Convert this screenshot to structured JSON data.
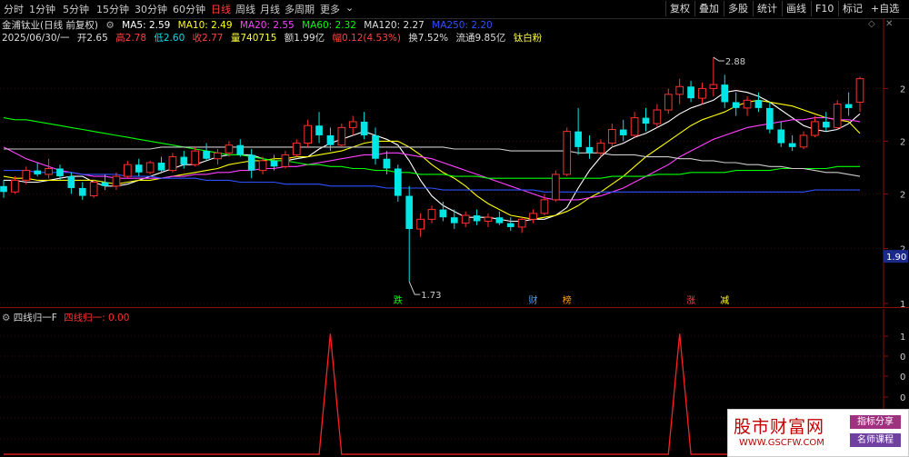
{
  "toolbar": {
    "timeframes": [
      "分时",
      "1分钟",
      "5分钟",
      "15分钟",
      "30分钟",
      "60分钟",
      "日线",
      "周线",
      "月线",
      "多周期",
      "更多"
    ],
    "active": "日线",
    "right_buttons": [
      "复权",
      "叠加",
      "多股",
      "统计",
      "画线",
      "F10",
      "标记",
      "+自选",
      "◁",
      "▷"
    ]
  },
  "header": {
    "stock_title": "金浦钛业(日线 前复权)",
    "ma_labels": [
      {
        "text": "MA5: 2.59",
        "color": "#ffffff"
      },
      {
        "text": "MA10: 2.49",
        "color": "#ffff00"
      },
      {
        "text": "MA20: 2.55",
        "color": "#ff40ff"
      },
      {
        "text": "MA60: 2.32",
        "color": "#00ff00"
      },
      {
        "text": "MA120: 2.27",
        "color": "#dddddd"
      },
      {
        "text": "MA250: 2.20",
        "color": "#3050ff"
      }
    ],
    "bar_info": [
      {
        "text": "2025/06/30/一",
        "color": "#dddddd"
      },
      {
        "text": "开2.65",
        "color": "#dddddd"
      },
      {
        "text": "高2.78",
        "color": "#ff4040"
      },
      {
        "text": "低2.60",
        "color": "#00e0e0"
      },
      {
        "text": "收2.77",
        "color": "#ff4040"
      },
      {
        "text": "量740715",
        "color": "#ffff40"
      },
      {
        "text": "额1.99亿",
        "color": "#dddddd"
      },
      {
        "text": "幅0.12(4.53%)",
        "color": "#ff4040"
      },
      {
        "text": "换7.52%",
        "color": "#dddddd"
      },
      {
        "text": "流通9.85亿",
        "color": "#dddddd"
      },
      {
        "text": "钛白粉",
        "color": "#ffff40"
      }
    ]
  },
  "chart_data": [
    {
      "type": "candlestick",
      "title": "金浦钛业(日线 前复权)",
      "ylim": [
        1.6,
        2.95
      ],
      "y_ticks": [
        "2",
        "2",
        "2",
        "2",
        "1"
      ],
      "price_marker": "1.90",
      "annotations": [
        {
          "text": "2.88",
          "kind": "high",
          "value": 2.88
        },
        {
          "text": "1.73",
          "kind": "low",
          "value": 1.73
        }
      ],
      "event_tags": [
        {
          "text": "跌",
          "color": "#00ff00",
          "index": 35
        },
        {
          "text": "财",
          "color": "#40a0ff",
          "index": 47
        },
        {
          "text": "榜",
          "color": "#ffa000",
          "index": 50
        },
        {
          "text": "涨",
          "color": "#ff4040",
          "index": 61
        },
        {
          "text": "减",
          "color": "#ffff00",
          "index": 64
        }
      ],
      "ohlc": [
        [
          2.22,
          2.25,
          2.16,
          2.19
        ],
        [
          2.19,
          2.27,
          2.18,
          2.25
        ],
        [
          2.25,
          2.32,
          2.23,
          2.3
        ],
        [
          2.3,
          2.34,
          2.27,
          2.28
        ],
        [
          2.28,
          2.36,
          2.26,
          2.31
        ],
        [
          2.31,
          2.33,
          2.25,
          2.27
        ],
        [
          2.27,
          2.29,
          2.18,
          2.21
        ],
        [
          2.21,
          2.24,
          2.15,
          2.17
        ],
        [
          2.17,
          2.25,
          2.16,
          2.24
        ],
        [
          2.24,
          2.28,
          2.2,
          2.22
        ],
        [
          2.22,
          2.29,
          2.2,
          2.27
        ],
        [
          2.27,
          2.35,
          2.26,
          2.33
        ],
        [
          2.33,
          2.36,
          2.27,
          2.29
        ],
        [
          2.29,
          2.35,
          2.28,
          2.34
        ],
        [
          2.34,
          2.37,
          2.29,
          2.3
        ],
        [
          2.3,
          2.39,
          2.29,
          2.37
        ],
        [
          2.37,
          2.4,
          2.31,
          2.33
        ],
        [
          2.33,
          2.42,
          2.32,
          2.4
        ],
        [
          2.4,
          2.44,
          2.35,
          2.36
        ],
        [
          2.36,
          2.41,
          2.33,
          2.39
        ],
        [
          2.39,
          2.45,
          2.37,
          2.43
        ],
        [
          2.43,
          2.46,
          2.37,
          2.38
        ],
        [
          2.38,
          2.41,
          2.26,
          2.3
        ],
        [
          2.3,
          2.37,
          2.28,
          2.35
        ],
        [
          2.35,
          2.38,
          2.3,
          2.32
        ],
        [
          2.32,
          2.4,
          2.31,
          2.38
        ],
        [
          2.38,
          2.46,
          2.37,
          2.44
        ],
        [
          2.44,
          2.56,
          2.42,
          2.53
        ],
        [
          2.53,
          2.6,
          2.44,
          2.48
        ],
        [
          2.48,
          2.52,
          2.4,
          2.43
        ],
        [
          2.43,
          2.54,
          2.42,
          2.52
        ],
        [
          2.52,
          2.58,
          2.48,
          2.55
        ],
        [
          2.55,
          2.6,
          2.46,
          2.48
        ],
        [
          2.48,
          2.52,
          2.33,
          2.36
        ],
        [
          2.36,
          2.4,
          2.28,
          2.31
        ],
        [
          2.31,
          2.33,
          2.14,
          2.17
        ],
        [
          2.17,
          2.22,
          1.73,
          2.0
        ],
        [
          2.0,
          2.08,
          1.96,
          2.05
        ],
        [
          2.05,
          2.12,
          2.03,
          2.1
        ],
        [
          2.1,
          2.14,
          2.04,
          2.06
        ],
        [
          2.06,
          2.1,
          2.0,
          2.03
        ],
        [
          2.03,
          2.09,
          2.01,
          2.07
        ],
        [
          2.07,
          2.1,
          2.02,
          2.04
        ],
        [
          2.04,
          2.08,
          2.01,
          2.06
        ],
        [
          2.06,
          2.09,
          2.02,
          2.03
        ],
        [
          2.03,
          2.06,
          1.99,
          2.01
        ],
        [
          2.01,
          2.06,
          1.98,
          2.05
        ],
        [
          2.05,
          2.1,
          2.03,
          2.08
        ],
        [
          2.08,
          2.18,
          2.07,
          2.15
        ],
        [
          2.15,
          2.3,
          2.14,
          2.28
        ],
        [
          2.28,
          2.52,
          2.27,
          2.5
        ],
        [
          2.5,
          2.62,
          2.38,
          2.42
        ],
        [
          2.42,
          2.48,
          2.36,
          2.39
        ],
        [
          2.39,
          2.46,
          2.37,
          2.44
        ],
        [
          2.44,
          2.54,
          2.42,
          2.51
        ],
        [
          2.51,
          2.56,
          2.45,
          2.48
        ],
        [
          2.48,
          2.6,
          2.47,
          2.57
        ],
        [
          2.57,
          2.62,
          2.5,
          2.54
        ],
        [
          2.54,
          2.64,
          2.52,
          2.61
        ],
        [
          2.61,
          2.72,
          2.59,
          2.69
        ],
        [
          2.69,
          2.77,
          2.64,
          2.73
        ],
        [
          2.73,
          2.76,
          2.65,
          2.67
        ],
        [
          2.67,
          2.75,
          2.64,
          2.72
        ],
        [
          2.72,
          2.88,
          2.68,
          2.74
        ],
        [
          2.74,
          2.79,
          2.62,
          2.65
        ],
        [
          2.65,
          2.7,
          2.58,
          2.62
        ],
        [
          2.62,
          2.68,
          2.58,
          2.66
        ],
        [
          2.66,
          2.7,
          2.6,
          2.62
        ],
        [
          2.62,
          2.65,
          2.49,
          2.51
        ],
        [
          2.51,
          2.55,
          2.42,
          2.44
        ],
        [
          2.44,
          2.48,
          2.4,
          2.42
        ],
        [
          2.42,
          2.5,
          2.41,
          2.48
        ],
        [
          2.48,
          2.58,
          2.47,
          2.55
        ],
        [
          2.55,
          2.6,
          2.5,
          2.52
        ],
        [
          2.52,
          2.66,
          2.51,
          2.64
        ],
        [
          2.64,
          2.7,
          2.58,
          2.62
        ],
        [
          2.65,
          2.78,
          2.6,
          2.77
        ]
      ],
      "ma": [
        {
          "name": "MA5",
          "color": "#ffffff",
          "values": [
            2.25,
            2.25,
            2.24,
            2.24,
            2.25,
            2.26,
            2.27,
            2.27,
            2.24,
            2.22,
            2.22,
            2.23,
            2.25,
            2.27,
            2.29,
            2.31,
            2.33,
            2.33,
            2.35,
            2.37,
            2.38,
            2.38,
            2.38,
            2.36,
            2.35,
            2.35,
            2.36,
            2.37,
            2.41,
            2.44,
            2.46,
            2.48,
            2.5,
            2.48,
            2.46,
            2.43,
            2.35,
            2.25,
            2.17,
            2.12,
            2.09,
            2.06,
            2.06,
            2.06,
            2.05,
            2.04,
            2.04,
            2.05,
            2.05,
            2.07,
            2.11,
            2.21,
            2.3,
            2.37,
            2.42,
            2.44,
            2.47,
            2.49,
            2.52,
            2.55,
            2.59,
            2.62,
            2.64,
            2.66,
            2.7,
            2.71,
            2.7,
            2.68,
            2.65,
            2.61,
            2.57,
            2.53,
            2.51,
            2.5,
            2.51,
            2.54,
            2.59
          ]
        },
        {
          "name": "MA10",
          "color": "#ffff00",
          "values": [
            2.27,
            2.26,
            2.26,
            2.25,
            2.25,
            2.25,
            2.25,
            2.25,
            2.25,
            2.24,
            2.23,
            2.24,
            2.25,
            2.25,
            2.26,
            2.27,
            2.28,
            2.29,
            2.3,
            2.31,
            2.33,
            2.34,
            2.35,
            2.35,
            2.36,
            2.36,
            2.37,
            2.37,
            2.38,
            2.39,
            2.4,
            2.42,
            2.44,
            2.45,
            2.45,
            2.45,
            2.42,
            2.38,
            2.33,
            2.29,
            2.26,
            2.22,
            2.17,
            2.13,
            2.1,
            2.07,
            2.06,
            2.05,
            2.06,
            2.07,
            2.09,
            2.12,
            2.16,
            2.19,
            2.23,
            2.27,
            2.32,
            2.37,
            2.41,
            2.45,
            2.49,
            2.53,
            2.56,
            2.58,
            2.6,
            2.63,
            2.65,
            2.66,
            2.65,
            2.64,
            2.63,
            2.61,
            2.59,
            2.57,
            2.56,
            2.55,
            2.49
          ]
        },
        {
          "name": "MA20",
          "color": "#ff40ff",
          "values": [
            2.42,
            2.39,
            2.36,
            2.34,
            2.32,
            2.3,
            2.29,
            2.28,
            2.27,
            2.27,
            2.26,
            2.26,
            2.26,
            2.26,
            2.26,
            2.27,
            2.27,
            2.28,
            2.28,
            2.29,
            2.29,
            2.3,
            2.3,
            2.31,
            2.31,
            2.32,
            2.32,
            2.33,
            2.34,
            2.35,
            2.36,
            2.37,
            2.38,
            2.38,
            2.39,
            2.39,
            2.38,
            2.37,
            2.36,
            2.34,
            2.32,
            2.3,
            2.28,
            2.26,
            2.24,
            2.22,
            2.2,
            2.18,
            2.16,
            2.15,
            2.15,
            2.15,
            2.16,
            2.17,
            2.19,
            2.21,
            2.24,
            2.27,
            2.3,
            2.33,
            2.37,
            2.4,
            2.43,
            2.46,
            2.48,
            2.5,
            2.52,
            2.53,
            2.54,
            2.55,
            2.56,
            2.56,
            2.57,
            2.57,
            2.56,
            2.56,
            2.55
          ]
        },
        {
          "name": "MA60",
          "color": "#00ff00",
          "values": [
            2.57,
            2.56,
            2.56,
            2.55,
            2.54,
            2.53,
            2.52,
            2.51,
            2.5,
            2.49,
            2.48,
            2.47,
            2.46,
            2.45,
            2.44,
            2.43,
            2.42,
            2.41,
            2.4,
            2.39,
            2.38,
            2.38,
            2.37,
            2.36,
            2.35,
            2.35,
            2.34,
            2.33,
            2.33,
            2.32,
            2.32,
            2.31,
            2.31,
            2.3,
            2.3,
            2.29,
            2.29,
            2.28,
            2.28,
            2.28,
            2.27,
            2.27,
            2.27,
            2.26,
            2.26,
            2.26,
            2.26,
            2.26,
            2.26,
            2.26,
            2.26,
            2.26,
            2.26,
            2.26,
            2.27,
            2.27,
            2.27,
            2.27,
            2.28,
            2.28,
            2.28,
            2.29,
            2.29,
            2.29,
            2.29,
            2.3,
            2.3,
            2.3,
            2.3,
            2.31,
            2.31,
            2.31,
            2.31,
            2.31,
            2.32,
            2.32,
            2.32
          ]
        },
        {
          "name": "MA120",
          "color": "#cccccc",
          "values": [
            2.41,
            2.41,
            2.41,
            2.41,
            2.41,
            2.41,
            2.41,
            2.41,
            2.41,
            2.41,
            2.41,
            2.41,
            2.41,
            2.41,
            2.42,
            2.42,
            2.42,
            2.42,
            2.42,
            2.42,
            2.42,
            2.42,
            2.42,
            2.42,
            2.42,
            2.42,
            2.42,
            2.42,
            2.42,
            2.42,
            2.42,
            2.42,
            2.42,
            2.42,
            2.42,
            2.42,
            2.42,
            2.42,
            2.42,
            2.42,
            2.41,
            2.41,
            2.41,
            2.41,
            2.41,
            2.4,
            2.4,
            2.4,
            2.4,
            2.4,
            2.4,
            2.39,
            2.39,
            2.39,
            2.38,
            2.38,
            2.38,
            2.37,
            2.37,
            2.37,
            2.36,
            2.36,
            2.35,
            2.35,
            2.34,
            2.34,
            2.33,
            2.33,
            2.32,
            2.32,
            2.31,
            2.31,
            2.3,
            2.29,
            2.29,
            2.28,
            2.27
          ]
        },
        {
          "name": "MA250",
          "color": "#3050ff",
          "values": [
            2.3,
            2.3,
            2.3,
            2.29,
            2.29,
            2.29,
            2.29,
            2.28,
            2.28,
            2.28,
            2.28,
            2.27,
            2.27,
            2.27,
            2.26,
            2.26,
            2.26,
            2.26,
            2.25,
            2.25,
            2.25,
            2.24,
            2.24,
            2.24,
            2.24,
            2.23,
            2.23,
            2.23,
            2.23,
            2.22,
            2.22,
            2.22,
            2.22,
            2.22,
            2.21,
            2.21,
            2.21,
            2.21,
            2.21,
            2.2,
            2.2,
            2.2,
            2.2,
            2.2,
            2.2,
            2.2,
            2.2,
            2.2,
            2.19,
            2.19,
            2.19,
            2.19,
            2.19,
            2.19,
            2.19,
            2.19,
            2.19,
            2.19,
            2.19,
            2.19,
            2.19,
            2.19,
            2.19,
            2.19,
            2.19,
            2.19,
            2.19,
            2.19,
            2.19,
            2.19,
            2.19,
            2.19,
            2.2,
            2.2,
            2.2,
            2.2,
            2.2
          ]
        }
      ]
    },
    {
      "type": "line",
      "title": "四线归一F",
      "series_label": "四线归一: 0.00",
      "ylim": [
        0,
        1.1
      ],
      "y_ticks": [
        "1",
        "0",
        "0",
        "0",
        "0",
        "0"
      ],
      "values": [
        0,
        0,
        0,
        0,
        0,
        0,
        0,
        0,
        0,
        0,
        0,
        0,
        0,
        0,
        0,
        0,
        0,
        0,
        0,
        0,
        0,
        0,
        0,
        0,
        0,
        0,
        0,
        0,
        0,
        0,
        0,
        0,
        0,
        0,
        0,
        0,
        0,
        0,
        0,
        0,
        0,
        0,
        0,
        0,
        0,
        0,
        0,
        0,
        0,
        0,
        0,
        0,
        0,
        0,
        0,
        0,
        0,
        0,
        0,
        0,
        0,
        0,
        0,
        0,
        0,
        0,
        0,
        0,
        0,
        0,
        0,
        0,
        0,
        0,
        0,
        0,
        0
      ],
      "spikes": [
        {
          "index": 29,
          "value": 1
        },
        {
          "index": 60,
          "value": 1
        }
      ],
      "color": "#ff2020"
    }
  ],
  "watermark": {
    "title": "股市财富网",
    "url": "WWW.GSCFW.COM",
    "tag1": "指标分享",
    "tag2": "名师课程"
  }
}
